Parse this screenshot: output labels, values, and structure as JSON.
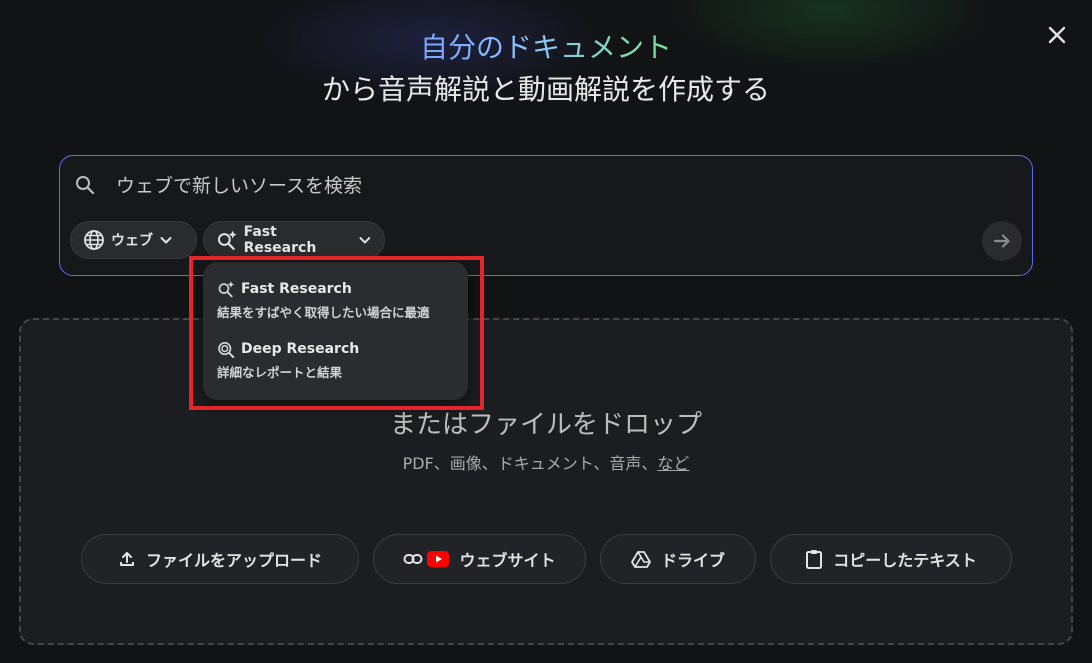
{
  "dialog": {
    "title_line1": "自分のドキュメント",
    "title_line2": "から音声解説と動画解説を作成する",
    "close_icon": "close-icon"
  },
  "search": {
    "placeholder": "ウェブで新しいソースを検索",
    "source_chip_label": "ウェブ",
    "mode_chip_label": "Fast Research",
    "send_icon": "arrow-right-icon"
  },
  "mode_dropdown": {
    "items": [
      {
        "label": "Fast Research",
        "description": "結果をすばやく取得したい場合に最適",
        "icon": "sparkle-search-icon"
      },
      {
        "label": "Deep Research",
        "description": "詳細なレポートと結果",
        "icon": "deep-search-icon"
      }
    ]
  },
  "drop_zone": {
    "title": "またはファイルをドロップ",
    "subtitle_prefix": "PDF、画像、ドキュメント、音声、",
    "subtitle_link": "など",
    "buttons": {
      "upload": "ファイルをアップロード",
      "website": "ウェブサイト",
      "drive": "ドライブ",
      "copied_text": "コピーしたテキスト"
    }
  },
  "colors": {
    "background": "#121315",
    "accent_border": "#5a6cf2",
    "highlight": "#e3262a",
    "youtube_red": "#ff0000"
  }
}
